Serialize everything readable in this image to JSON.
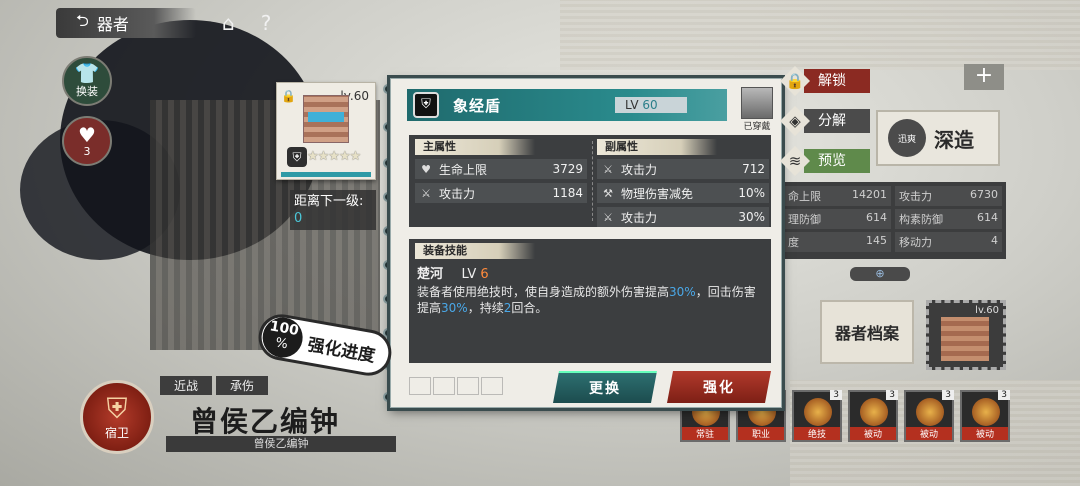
{
  "topbar": {
    "back_label": "器者"
  },
  "side_buttons": [
    {
      "name": "swap",
      "label": "换装"
    },
    {
      "name": "fetter",
      "badge": "3",
      "label": ""
    }
  ],
  "equipment_card": {
    "level": "lv.60",
    "stars": "★★★★★"
  },
  "next_level": {
    "label": "距离下一级:",
    "value": "0"
  },
  "detail": {
    "name": "象经盾",
    "level_label": "LV",
    "level_value": "60",
    "equipped_label": "已穿戴",
    "main_attr_title": "主属性",
    "sub_attr_title": "副属性",
    "main_attrs": [
      {
        "label": "生命上限",
        "value": "3729"
      },
      {
        "label": "攻击力",
        "value": "1184"
      }
    ],
    "sub_attrs": [
      {
        "label": "攻击力",
        "value": "712"
      },
      {
        "label": "物理伤害减免",
        "value": "10%"
      },
      {
        "label": "攻击力",
        "value": "30%"
      }
    ],
    "skill_title": "装备技能",
    "skill_name": "楚河",
    "skill_lv_label": "LV",
    "skill_lv_value": "6",
    "skill_desc_1": "装备者使用绝技时，使自身造成的额外伤害提高",
    "skill_desc_hl1": "30%",
    "skill_desc_2": "，回击伤害提高",
    "skill_desc_hl2": "30%",
    "skill_desc_3": "，持续",
    "skill_desc_hl3": "2",
    "skill_desc_4": "回合。",
    "replace_label": "更换",
    "upgrade_label": "强化"
  },
  "actions": {
    "unlock": "解锁",
    "decompose": "分解",
    "preview": "预览"
  },
  "progress": {
    "percent": "100",
    "unit": "%",
    "label": "强化进度"
  },
  "character": {
    "tags": [
      "近战",
      "承伤"
    ],
    "name": "曾侯乙编钟",
    "subtitle": "曾侯乙编钟",
    "badge_label": "宿卫"
  },
  "right_panel": {
    "deep_label": "深造",
    "deep_emblem": "迅爽",
    "stats": [
      [
        {
          "label": "命上限",
          "value": "14201"
        },
        {
          "label": "攻击力",
          "value": "6730"
        }
      ],
      [
        {
          "label": "理防御",
          "value": "614"
        },
        {
          "label": "构素防御",
          "value": "614"
        }
      ],
      [
        {
          "label": "度",
          "value": "145"
        },
        {
          "label": "移动力",
          "value": "4"
        }
      ]
    ],
    "archive_label": "器者档案",
    "thumb_level": "lv.60",
    "skills": [
      {
        "name": "常驻",
        "badge": ""
      },
      {
        "name": "职业",
        "badge": ""
      },
      {
        "name": "绝技",
        "badge": "3"
      },
      {
        "name": "被动",
        "badge": "3"
      },
      {
        "name": "被动",
        "badge": "3"
      },
      {
        "name": "被动",
        "badge": "3"
      }
    ]
  }
}
